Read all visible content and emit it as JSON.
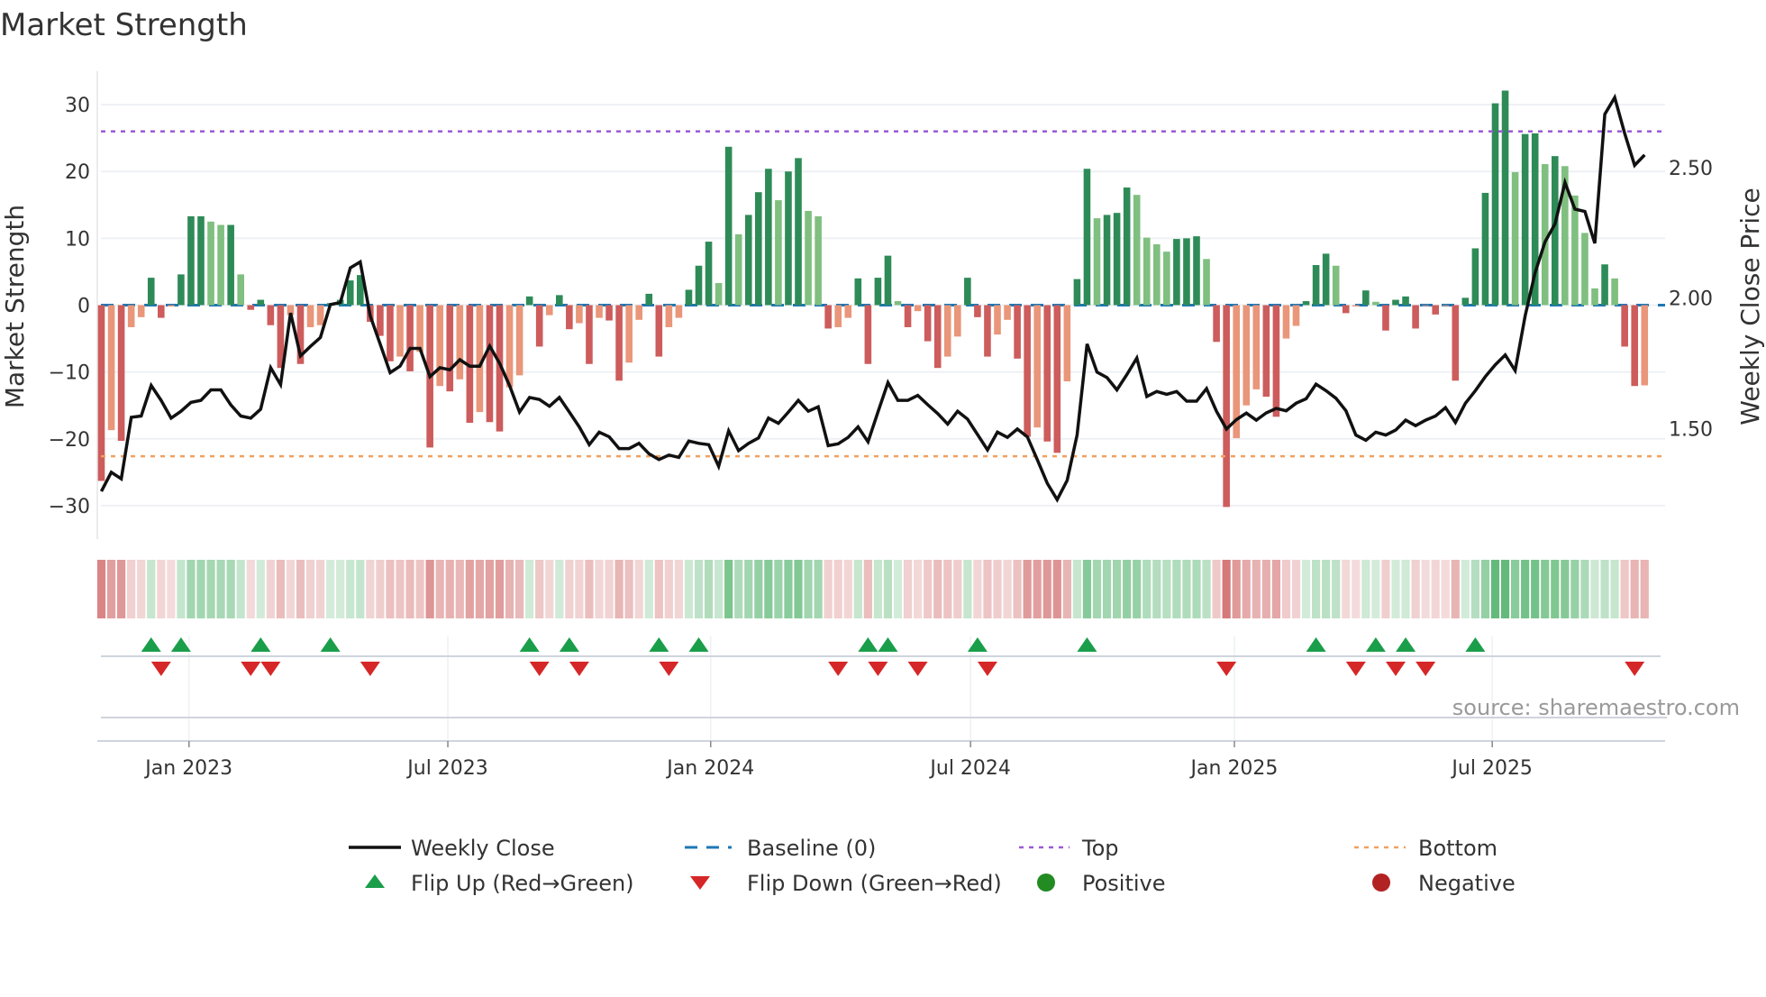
{
  "title": "Market Strength",
  "source": "source: sharemaestro.com",
  "colors": {
    "pos_strong": "#2e8b57",
    "pos_weak": "#7fbf7f",
    "neg_strong": "#cd5c5c",
    "neg_weak": "#e9967a",
    "heat_pos": "#41ab5d",
    "heat_neg": "#cd5c5c",
    "close": "#111111",
    "baseline": "#1f77b4",
    "top": "#9b59d6",
    "bottom": "#f0a060",
    "flip_up": "#1a9e4a",
    "flip_down": "#d62728",
    "positive": "#228b22",
    "negative": "#b22222"
  },
  "legend": {
    "weekly_close": "Weekly Close",
    "baseline": "Baseline (0)",
    "top": "Top",
    "bottom": "Bottom",
    "flip_up": "Flip Up (Red→Green)",
    "flip_down": "Flip Down (Green→Red)",
    "positive": "Positive",
    "negative": "Negative"
  },
  "chart_data": {
    "type": "bar",
    "title": "Market Strength",
    "ylabel": "Market Strength",
    "y2label": "Weekly Close Price",
    "ylim": [
      -35,
      35
    ],
    "y2lim": [
      1.076,
      2.87
    ],
    "yticks": [
      -30,
      -20,
      -10,
      0,
      10,
      20,
      30
    ],
    "y2ticks": [
      "1.50",
      "2.00",
      "2.50"
    ],
    "top_level": 26,
    "bottom_level": -22.6,
    "baseline": 0,
    "grid": "horizontal",
    "legend_position": "bottom",
    "xticks": [
      {
        "label": "Jan 2023",
        "week": 8.8
      },
      {
        "label": "Jul 2023",
        "week": 34.8
      },
      {
        "label": "Jan 2024",
        "week": 61.2
      },
      {
        "label": "Jul 2024",
        "week": 87.3
      },
      {
        "label": "Jan 2025",
        "week": 113.8
      },
      {
        "label": "Jul 2025",
        "week": 139.7
      }
    ],
    "strength": [
      -26.3,
      -18.7,
      -20.3,
      -3.3,
      -1.8,
      4.1,
      -1.9,
      -0.2,
      4.6,
      13.3,
      13.3,
      12.5,
      12.0,
      12.0,
      4.6,
      -0.7,
      0.8,
      -3.0,
      -9.4,
      -1.5,
      -8.8,
      -3.3,
      -3.0,
      0.3,
      0.8,
      3.7,
      4.5,
      -2.5,
      -4.6,
      -8.4,
      -7.7,
      -9.9,
      -7.0,
      -21.3,
      -12.1,
      -12.9,
      -11.1,
      -17.6,
      -16.0,
      -17.5,
      -18.9,
      -12.3,
      -10.5,
      1.3,
      -6.2,
      -1.5,
      1.5,
      -3.6,
      -2.7,
      -8.8,
      -1.9,
      -2.3,
      -11.3,
      -8.6,
      -2.2,
      1.7,
      -7.7,
      -3.3,
      -1.9,
      2.3,
      5.9,
      9.5,
      3.3,
      23.7,
      10.6,
      13.5,
      16.9,
      20.4,
      15.7,
      20.0,
      22.0,
      14.1,
      13.3,
      -3.5,
      -3.3,
      -1.9,
      4.0,
      -8.8,
      4.1,
      7.4,
      0.6,
      -3.3,
      -0.9,
      -5.4,
      -9.4,
      -7.7,
      -4.7,
      4.1,
      -1.8,
      -7.7,
      -4.4,
      -2.2,
      -8.0,
      -19.7,
      -18.3,
      -20.4,
      -22.1,
      -11.4,
      3.9,
      20.4,
      13.0,
      13.5,
      13.8,
      17.6,
      16.5,
      10.1,
      9.1,
      8.0,
      9.9,
      10.0,
      10.3,
      6.9,
      -5.5,
      -30.2,
      -19.9,
      -15.0,
      -12.6,
      -13.7,
      -16.7,
      -5.0,
      -3.1,
      0.6,
      6.0,
      7.7,
      5.9,
      -1.2,
      -0.2,
      2.2,
      0.5,
      -3.8,
      0.8,
      1.3,
      -3.5,
      -0.1,
      -1.4,
      -0.1,
      -11.3,
      1.1,
      8.5,
      16.8,
      30.2,
      32.1,
      19.9,
      25.6,
      25.7,
      21.1,
      22.3,
      20.8,
      16.4,
      10.8,
      2.5,
      6.1,
      4.0,
      -6.2,
      -12.1,
      -12.0
    ],
    "weekly_close": [
      1.259,
      1.332,
      1.307,
      1.543,
      1.548,
      1.665,
      1.608,
      1.54,
      1.566,
      1.6,
      1.608,
      1.648,
      1.648,
      1.591,
      1.548,
      1.54,
      1.574,
      1.733,
      1.668,
      1.943,
      1.778,
      1.815,
      1.849,
      1.975,
      1.983,
      2.116,
      2.139,
      1.932,
      1.824,
      1.714,
      1.739,
      1.807,
      1.807,
      1.699,
      1.733,
      1.725,
      1.764,
      1.739,
      1.739,
      1.816,
      1.75,
      1.665,
      1.563,
      1.619,
      1.611,
      1.585,
      1.619,
      1.563,
      1.506,
      1.438,
      1.486,
      1.468,
      1.423,
      1.423,
      1.443,
      1.403,
      1.381,
      1.398,
      1.389,
      1.452,
      1.443,
      1.438,
      1.355,
      1.491,
      1.415,
      1.443,
      1.464,
      1.54,
      1.52,
      1.563,
      1.608,
      1.566,
      1.583,
      1.434,
      1.441,
      1.466,
      1.506,
      1.449,
      1.563,
      1.676,
      1.608,
      1.608,
      1.627,
      1.591,
      1.557,
      1.517,
      1.566,
      1.536,
      1.477,
      1.418,
      1.486,
      1.466,
      1.498,
      1.468,
      1.381,
      1.29,
      1.227,
      1.301,
      1.475,
      1.824,
      1.716,
      1.695,
      1.648,
      1.707,
      1.77,
      1.623,
      1.642,
      1.631,
      1.642,
      1.605,
      1.605,
      1.653,
      1.566,
      1.498,
      1.534,
      1.559,
      1.532,
      1.56,
      1.577,
      1.568,
      1.597,
      1.614,
      1.67,
      1.645,
      1.616,
      1.568,
      1.475,
      1.455,
      1.486,
      1.475,
      1.494,
      1.532,
      1.511,
      1.532,
      1.548,
      1.58,
      1.523,
      1.597,
      1.645,
      1.699,
      1.744,
      1.782,
      1.722,
      1.932,
      2.097,
      2.216,
      2.284,
      2.443,
      2.341,
      2.332,
      2.21,
      2.705,
      2.769,
      2.631,
      2.509,
      2.549
    ],
    "flip_up_weeks": [
      5,
      8,
      16,
      23,
      43,
      47,
      56,
      60,
      77,
      79,
      88,
      99,
      122,
      128,
      131,
      138
    ],
    "flip_down_weeks": [
      6,
      15,
      17,
      27,
      44,
      48,
      57,
      74,
      78,
      82,
      89,
      113,
      126,
      130,
      133,
      154
    ]
  }
}
